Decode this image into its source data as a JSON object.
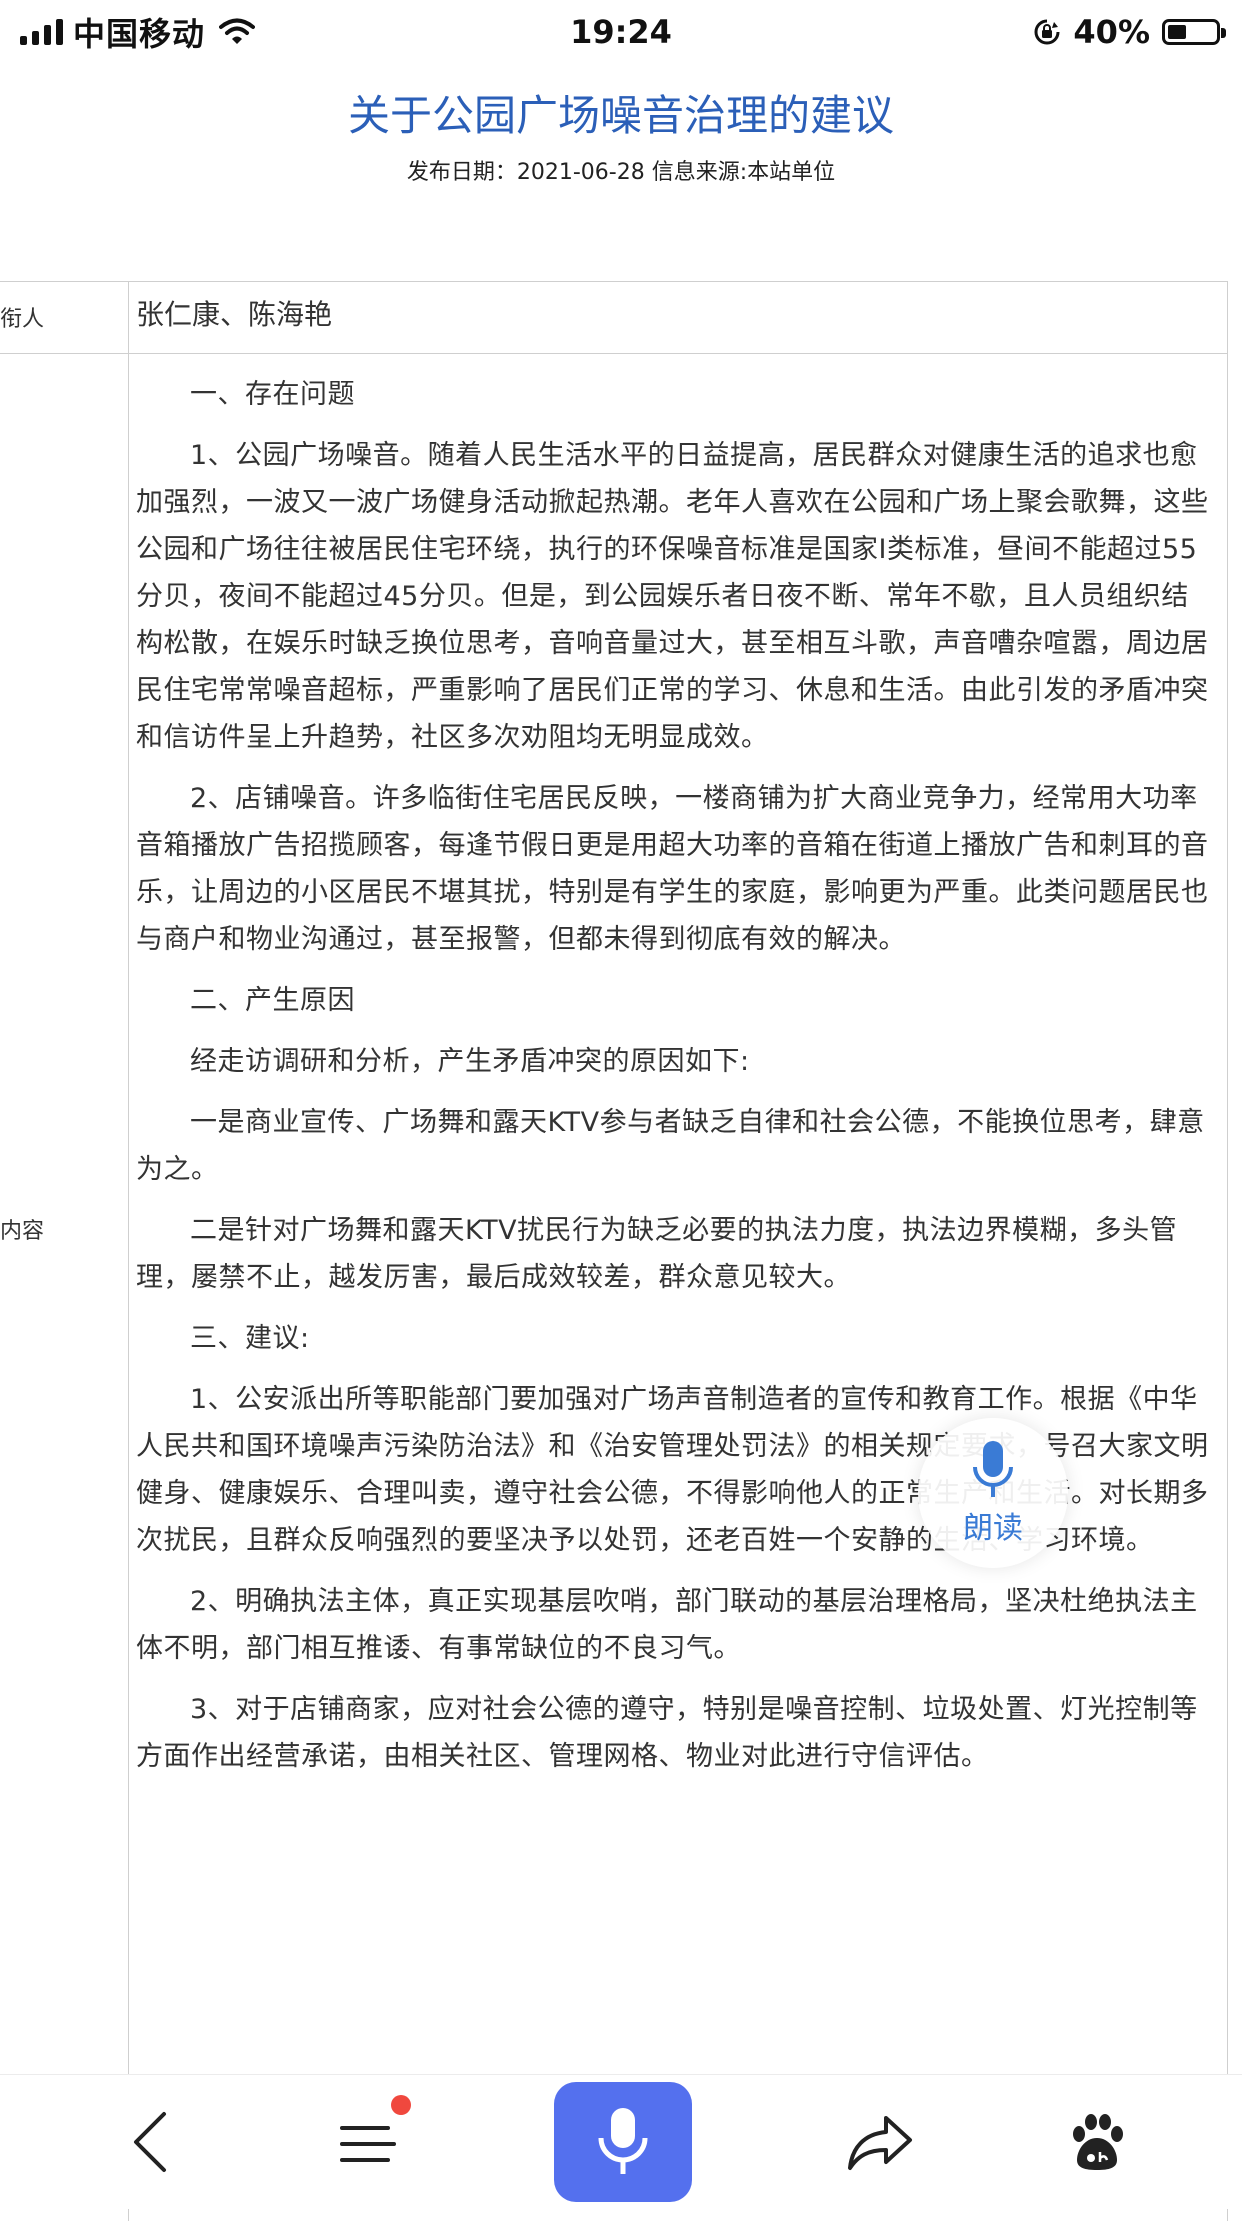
{
  "status_bar": {
    "carrier": "中国移动",
    "time": "19:24",
    "battery_percent": "40%",
    "battery_level": 0.4
  },
  "article": {
    "title": "关于公园广场噪音治理的建议",
    "meta": "发布日期：2021-06-28  信息来源:本站单位"
  },
  "table": {
    "row1_label": "衔人",
    "row1_value": "张仁康、陈海艳",
    "row2_label": "内容",
    "paragraphs": [
      "一、存在问题",
      "1、公园广场噪音。随着人民生活水平的日益提高，居民群众对健康生活的追求也愈加强烈，一波又一波广场健身活动掀起热潮。老年人喜欢在公园和广场上聚会歌舞，这些公园和广场往往被居民住宅环绕，执行的环保噪音标准是国家I类标准，昼间不能超过55分贝，夜间不能超过45分贝。但是，到公园娱乐者日夜不断、常年不歇，且人员组织结构松散，在娱乐时缺乏换位思考，音响音量过大，甚至相互斗歌，声音嘈杂喧嚣，周边居民住宅常常噪音超标，严重影响了居民们正常的学习、休息和生活。由此引发的矛盾冲突和信访件呈上升趋势，社区多次劝阻均无明显成效。",
      "2、店铺噪音。许多临街住宅居民反映，一楼商铺为扩大商业竞争力，经常用大功率音箱播放广告招揽顾客，每逢节假日更是用超大功率的音箱在街道上播放广告和刺耳的音乐，让周边的小区居民不堪其扰，特别是有学生的家庭，影响更为严重。此类问题居民也与商户和物业沟通过，甚至报警，但都未得到彻底有效的解决。",
      "二、产生原因",
      "经走访调研和分析，产生矛盾冲突的原因如下:",
      "一是商业宣传、广场舞和露天KTV参与者缺乏自律和社会公德，不能换位思考，肆意为之。",
      "二是针对广场舞和露天KTV扰民行为缺乏必要的执法力度，执法边界模糊，多头管理，屡禁不止，越发厉害，最后成效较差，群众意见较大。",
      "三、建议:",
      "1、公安派出所等职能部门要加强对广场声音制造者的宣传和教育工作。根据《中华人民共和国环境噪声污染防治法》和《治安管理处罚法》的相关规定要求，号召大家文明健身、健康娱乐、合理叫卖，遵守社会公德，不得影响他人的正常生产和生活。对长期多次扰民，且群众反响强烈的要坚决予以处罚，还老百姓一个安静的生活、学习环境。",
      "2、明确执法主体，真正实现基层吹哨，部门联动的基层治理格局，坚决杜绝执法主体不明，部门相互推诿、有事常缺位的不良习气。",
      "3、对于店铺商家，应对社会公德的遵守，特别是噪音控制、垃圾处置、灯光控制等方面作出经营承诺，由相关社区、管理网格、物业对此进行守信评估。"
    ]
  },
  "read_aloud": {
    "label": "朗读"
  },
  "toolbar": {
    "icons": [
      "back-icon",
      "menu-icon",
      "microphone-icon",
      "share-icon",
      "baidu-paw-icon"
    ],
    "accent_color": "#5470ee",
    "notification_color": "#f0483e"
  }
}
